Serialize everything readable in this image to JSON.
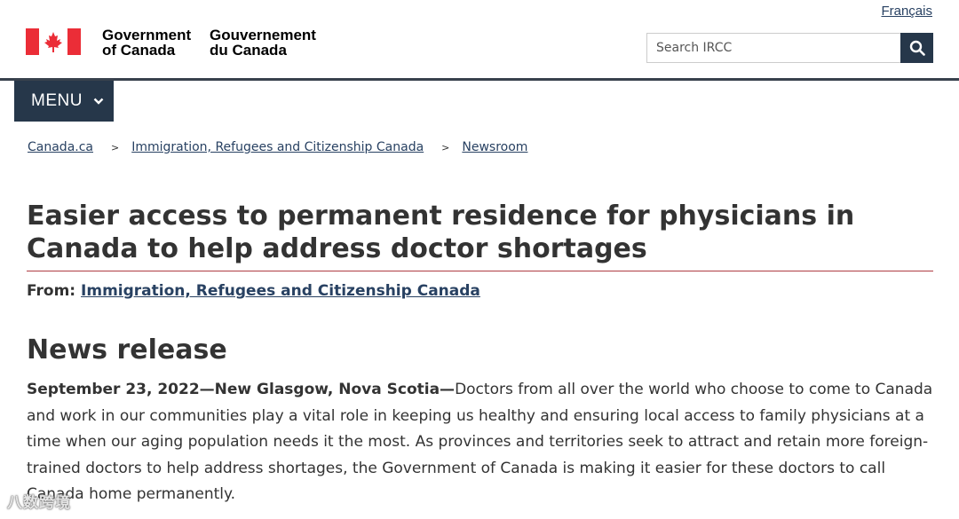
{
  "header": {
    "language_link": "Français",
    "signature_en_line1": "Government",
    "signature_en_line2": "of Canada",
    "signature_fr_line1": "Gouvernement",
    "signature_fr_line2": "du Canada",
    "search_placeholder": "Search IRCC",
    "search_icon": "magnifier-icon"
  },
  "menu": {
    "label": "MENU",
    "icon": "chevron-down-icon"
  },
  "breadcrumb": {
    "items": [
      "Canada.ca",
      "Immigration, Refugees and Citizenship Canada",
      "Newsroom"
    ],
    "separator": ">"
  },
  "article": {
    "title": "Easier access to permanent residence for physicians in Canada to help address doctor shortages",
    "from_label": "From:",
    "from_link": "Immigration, Refugees and Citizenship Canada",
    "section_heading": "News release",
    "dateline": "September 23, 2022—New Glasgow, Nova Scotia—",
    "body": "Doctors from all over the world who choose to come to Canada and work in our communities play a vital role in keeping us healthy and ensuring local access to family physicians at a time when our aging population needs it the most. As provinces and territories seek to attract and retain more foreign-trained doctors to help address shortages, the Government of Canada is making it easier for these doctors to call Canada home permanently."
  },
  "watermark": {
    "text": "八数跨境"
  },
  "colors": {
    "nav_dark": "#26374a",
    "link": "#284162",
    "title_rule": "#af3c43",
    "flag_red": "#eb2d37"
  }
}
